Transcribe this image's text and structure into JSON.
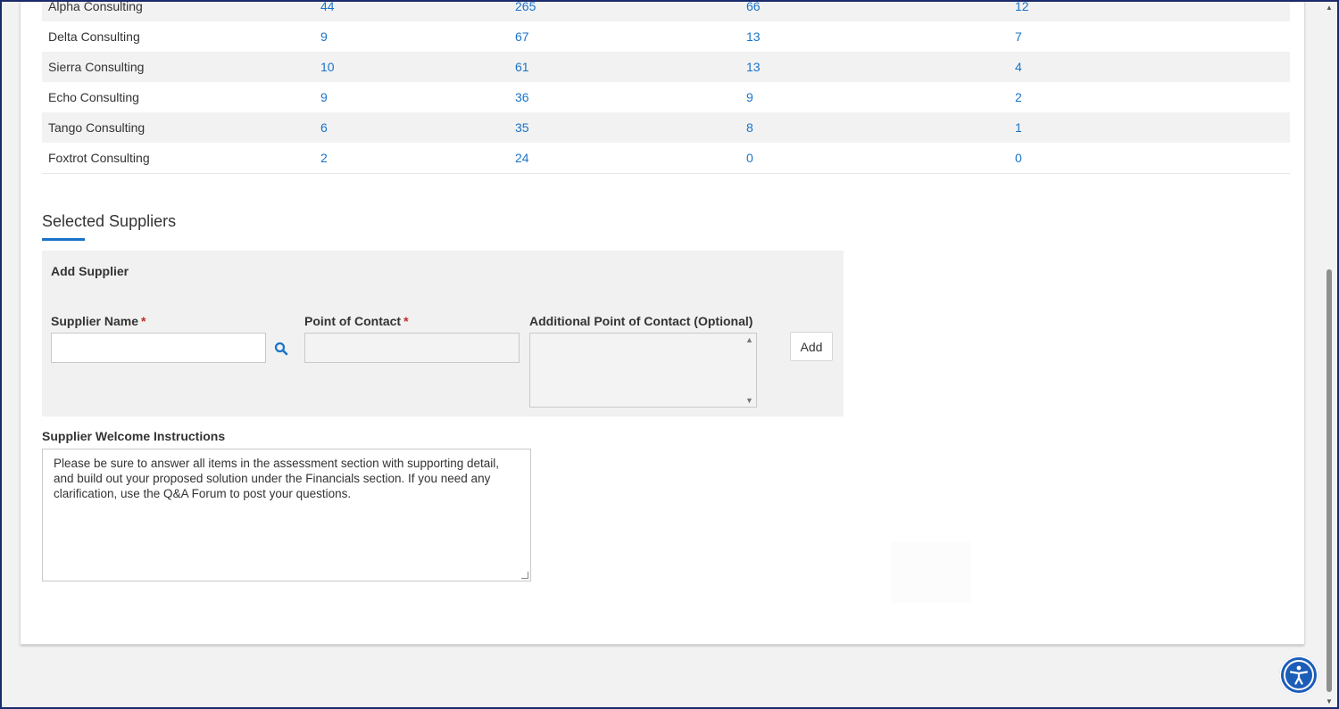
{
  "table": {
    "rows": [
      {
        "name": "Alpha Consulting",
        "v1": "44",
        "v2": "265",
        "v3": "66",
        "v4": "12"
      },
      {
        "name": "Delta Consulting",
        "v1": "9",
        "v2": "67",
        "v3": "13",
        "v4": "7"
      },
      {
        "name": "Sierra Consulting",
        "v1": "10",
        "v2": "61",
        "v3": "13",
        "v4": "4"
      },
      {
        "name": "Echo Consulting",
        "v1": "9",
        "v2": "36",
        "v3": "9",
        "v4": "2"
      },
      {
        "name": "Tango Consulting",
        "v1": "6",
        "v2": "35",
        "v3": "8",
        "v4": "1"
      },
      {
        "name": "Foxtrot Consulting",
        "v1": "2",
        "v2": "24",
        "v3": "0",
        "v4": "0"
      }
    ]
  },
  "selected_suppliers": {
    "title": "Selected Suppliers",
    "add_supplier": {
      "title": "Add Supplier",
      "supplier_name_label": "Supplier Name",
      "supplier_name_value": "",
      "point_of_contact_label": "Point of Contact",
      "point_of_contact_value": "",
      "additional_contact_label": "Additional Point of Contact (Optional)",
      "required_marker": "*",
      "add_button": "Add"
    }
  },
  "welcome": {
    "label": "Supplier Welcome Instructions",
    "text": "Please be sure to answer all items in the assessment section with supporting detail, and build out your proposed solution under the Financials section. If you need any clarification, use the Q&A Forum to post your questions."
  },
  "icons": {
    "search": "search-icon",
    "accessibility": "accessibility-icon"
  },
  "colors": {
    "accent": "#1a73c8",
    "required": "#c62828",
    "accessibility_button": "#1c5db8"
  }
}
